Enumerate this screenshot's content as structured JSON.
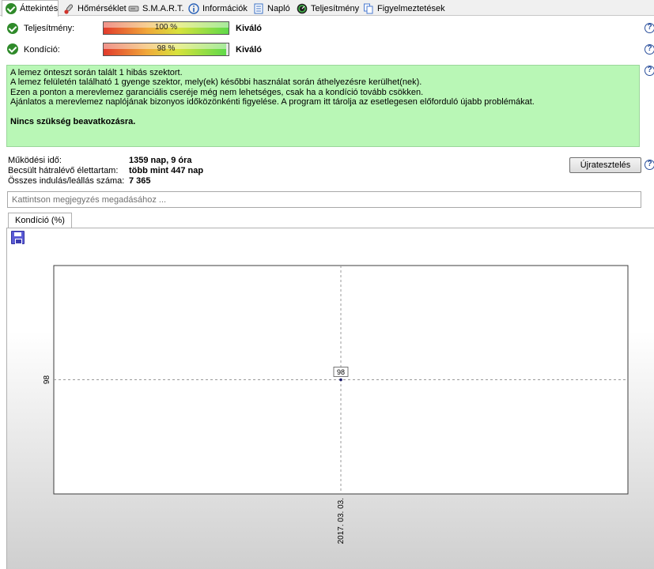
{
  "tabs": [
    {
      "label": "Áttekintés",
      "icon": "check-circle-icon",
      "active": true
    },
    {
      "label": "Hőmérséklet",
      "icon": "thermometer-icon"
    },
    {
      "label": "S.M.A.R.T.",
      "icon": "hard-disk-icon"
    },
    {
      "label": "Információk",
      "icon": "info-icon"
    },
    {
      "label": "Napló",
      "icon": "log-document-icon"
    },
    {
      "label": "Teljesítmény",
      "icon": "speedometer-icon"
    },
    {
      "label": "Figyelmeztetések",
      "icon": "copy-document-icon"
    }
  ],
  "status": {
    "performance": {
      "label": "Teljesítmény:",
      "percent_text": "100 %",
      "value": 100,
      "rating": "Kiváló"
    },
    "health": {
      "label": "Kondíció:",
      "percent_text": "98 %",
      "value": 98,
      "rating": "Kiváló"
    }
  },
  "info": {
    "lines": [
      "A lemez önteszt során talált 1 hibás szektort.",
      "A lemez felületén található 1 gyenge szektor, mely(ek) későbbi használat során áthelyezésre kerülhet(nek).",
      "Ezen a ponton a merevlemez garanciális cseréje még nem lehetséges, csak ha a kondíció tovább csökken.",
      "Ajánlatos a merevlemez naplójának bizonyos időközönkénti figyelése. A program itt tárolja az esetlegesen előforduló újabb problémákat."
    ],
    "action": "Nincs szükség beavatkozásra."
  },
  "stats": {
    "uptime_label": "Működési idő:",
    "uptime_value": "1359 nap, 9 óra",
    "remaining_label": "Becsült hátralévő élettartam:",
    "remaining_value": "több mint 447 nap",
    "startstop_label": "Összes indulás/leállás száma:",
    "startstop_value": "7 365"
  },
  "retest_label": "Újratesztelés",
  "note_placeholder": "Kattintson megjegyzés megadásához ...",
  "chart_tab": "Kondíció  (%)",
  "chart_data": {
    "type": "line",
    "x": [
      "2017. 03. 03."
    ],
    "series": [
      {
        "values": [
          98
        ]
      }
    ],
    "x_tick_labels": [
      "2017. 03. 03."
    ],
    "y_tick_labels": [
      "98"
    ],
    "point_labels": [
      "98"
    ],
    "grid": true
  },
  "colors": {
    "accent_green": "#2f8a2a",
    "info_background": "#b9f7b6",
    "help_blue": "#2a4f9c"
  }
}
